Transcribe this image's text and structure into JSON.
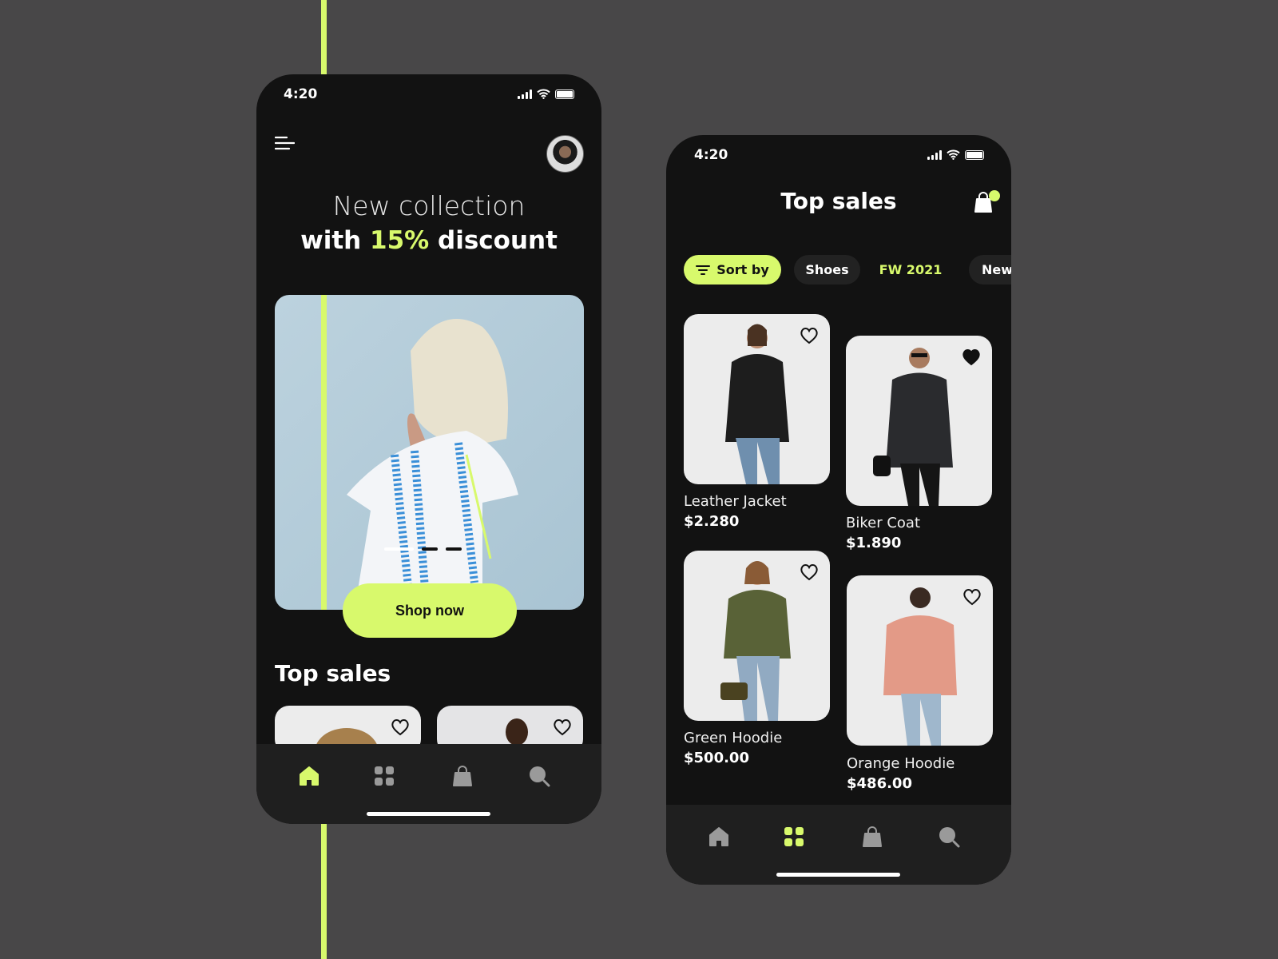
{
  "colors": {
    "accent": "#d8f96c",
    "background": "#484748",
    "phone": "#121212",
    "nav": "#1f1f1f"
  },
  "home": {
    "status_time": "4:20",
    "hero_line1": "New collection",
    "hero_line2_pre": "with ",
    "hero_line2_highlight": "15%",
    "hero_line2_post": " discount",
    "shop_button": "Shop now",
    "carousel": {
      "pages": 3,
      "active": 1
    },
    "section_title": "Top sales",
    "nav": [
      {
        "icon": "home-icon",
        "active": true
      },
      {
        "icon": "grid-icon",
        "active": false
      },
      {
        "icon": "bag-icon",
        "active": false
      },
      {
        "icon": "search-icon",
        "active": false
      }
    ]
  },
  "listing": {
    "status_time": "4:20",
    "title": "Top sales",
    "chips": [
      {
        "label": "Sort by",
        "icon": "filter-icon",
        "active": true
      },
      {
        "label": "Shoes"
      },
      {
        "label": "FW 2021",
        "highlight": true
      },
      {
        "label": "New"
      }
    ],
    "products": [
      {
        "name": "Leather Jacket",
        "price": "$2.280",
        "favorite": false
      },
      {
        "name": "Biker Coat",
        "price": "$1.890",
        "favorite": true
      },
      {
        "name": "Green Hoodie",
        "price": "$500.00",
        "favorite": false
      },
      {
        "name": "Orange Hoodie",
        "price": "$486.00",
        "favorite": false
      }
    ],
    "nav": [
      {
        "icon": "home-icon",
        "active": false
      },
      {
        "icon": "grid-icon",
        "active": true
      },
      {
        "icon": "bag-icon",
        "active": false
      },
      {
        "icon": "search-icon",
        "active": false
      }
    ]
  }
}
